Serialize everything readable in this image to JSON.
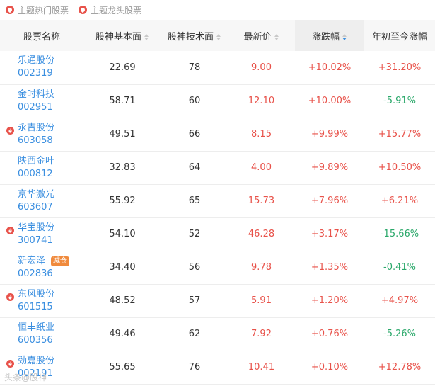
{
  "tabs": [
    "主题热门股票",
    "主题龙头股票"
  ],
  "columns": [
    "股票名称",
    "股神基本面",
    "股神技术面",
    "最新价",
    "涨跌幅",
    "年初至今涨幅"
  ],
  "rows": [
    {
      "name": "乐通股份",
      "code": "002319",
      "fundamental": "22.69",
      "technical": "78",
      "price": "9.00",
      "change": "+10.02%",
      "ytd": "+31.20%",
      "fire": false,
      "badge": ""
    },
    {
      "name": "金时科技",
      "code": "002951",
      "fundamental": "58.71",
      "technical": "60",
      "price": "12.10",
      "change": "+10.00%",
      "ytd": "-5.91%",
      "fire": false,
      "badge": ""
    },
    {
      "name": "永吉股份",
      "code": "603058",
      "fundamental": "49.51",
      "technical": "66",
      "price": "8.15",
      "change": "+9.99%",
      "ytd": "+15.77%",
      "fire": true,
      "badge": ""
    },
    {
      "name": "陕西金叶",
      "code": "000812",
      "fundamental": "32.83",
      "technical": "64",
      "price": "4.00",
      "change": "+9.89%",
      "ytd": "+10.50%",
      "fire": false,
      "badge": ""
    },
    {
      "name": "京华激光",
      "code": "603607",
      "fundamental": "55.92",
      "technical": "65",
      "price": "15.73",
      "change": "+7.96%",
      "ytd": "+6.21%",
      "fire": false,
      "badge": ""
    },
    {
      "name": "华宝股份",
      "code": "300741",
      "fundamental": "54.10",
      "technical": "52",
      "price": "46.28",
      "change": "+3.17%",
      "ytd": "-15.66%",
      "fire": true,
      "badge": ""
    },
    {
      "name": "新宏泽",
      "code": "002836",
      "fundamental": "34.40",
      "technical": "56",
      "price": "9.78",
      "change": "+1.35%",
      "ytd": "-0.41%",
      "fire": false,
      "badge": "减仓"
    },
    {
      "name": "东风股份",
      "code": "601515",
      "fundamental": "48.52",
      "technical": "57",
      "price": "5.91",
      "change": "+1.20%",
      "ytd": "+4.97%",
      "fire": true,
      "badge": ""
    },
    {
      "name": "恒丰纸业",
      "code": "600356",
      "fundamental": "49.46",
      "technical": "62",
      "price": "7.92",
      "change": "+0.76%",
      "ytd": "-5.26%",
      "fire": false,
      "badge": ""
    },
    {
      "name": "劲嘉股份",
      "code": "002191",
      "fundamental": "55.65",
      "technical": "76",
      "price": "10.41",
      "change": "+0.10%",
      "ytd": "+12.78%",
      "fire": true,
      "badge": ""
    }
  ],
  "colors": {
    "red": "#e8524a",
    "green": "#2aa86a",
    "blue": "#3b8fe0",
    "badge": "#f08a3c"
  },
  "watermark": "头条@股神"
}
